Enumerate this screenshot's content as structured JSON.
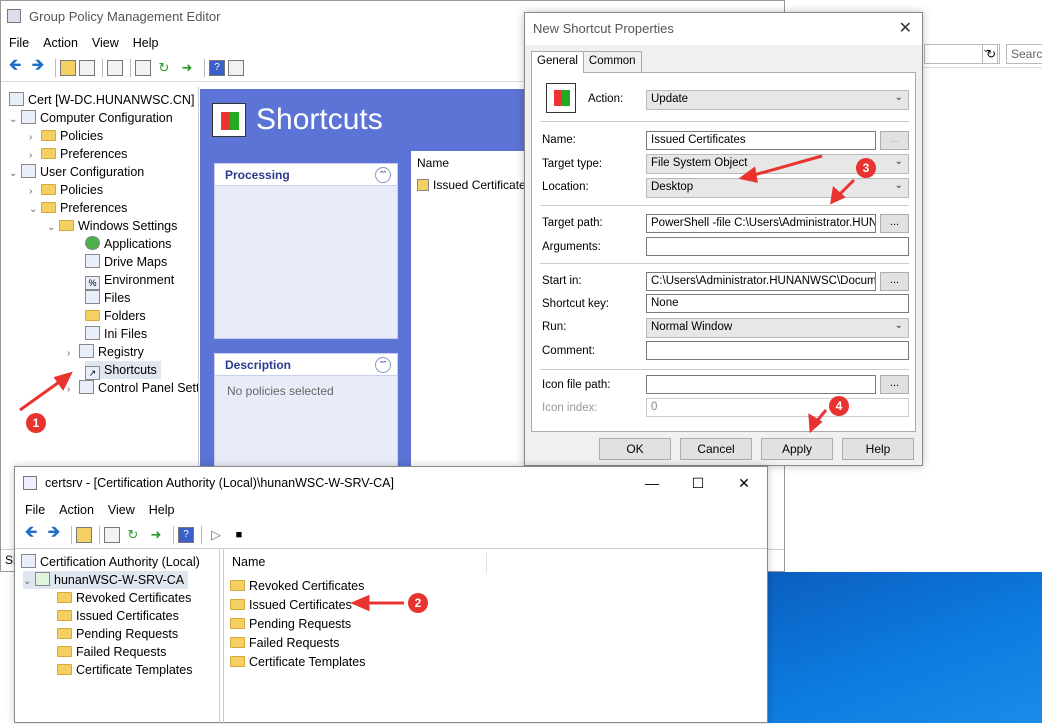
{
  "gpme": {
    "title": "Group Policy Management Editor",
    "menu": [
      "File",
      "Action",
      "View",
      "Help"
    ],
    "tree": {
      "root": "Cert [W-DC.HUNANWSC.CN] P",
      "computer_config": "Computer Configuration",
      "policies1": "Policies",
      "preferences1": "Preferences",
      "user_config": "User Configuration",
      "policies2": "Policies",
      "preferences2": "Preferences",
      "windows_settings": "Windows Settings",
      "applications": "Applications",
      "drive_maps": "Drive Maps",
      "environment": "Environment",
      "files": "Files",
      "folders": "Folders",
      "ini_files": "Ini Files",
      "registry": "Registry",
      "shortcuts": "Shortcuts",
      "control_panel": "Control Panel Setting"
    },
    "pane_title": "Shortcuts",
    "processing": "Processing",
    "description": "Description",
    "no_policies": "No policies selected",
    "list_header": "Name",
    "list_item": "Issued Certificate",
    "status": "Sh"
  },
  "browser": {
    "search_placeholder": "Searc"
  },
  "dialog": {
    "title": "New Shortcut Properties",
    "tabs": [
      "General",
      "Common"
    ],
    "action_label": "Action:",
    "action_value": "Update",
    "name_label": "Name:",
    "name_value": "Issued Certificates",
    "target_type_label": "Target type:",
    "target_type_value": "File System Object",
    "location_label": "Location:",
    "location_value": "Desktop",
    "target_path_label": "Target path:",
    "target_path_value": "PowerShell -file C:\\Users\\Administrator.HUNAN",
    "arguments_label": "Arguments:",
    "arguments_value": "",
    "start_in_label": "Start in:",
    "start_in_value": "C:\\Users\\Administrator.HUNANWSC\\Document",
    "shortcut_key_label": "Shortcut key:",
    "shortcut_key_value": "None",
    "run_label": "Run:",
    "run_value": "Normal Window",
    "comment_label": "Comment:",
    "comment_value": "",
    "icon_path_label": "Icon file path:",
    "icon_path_value": "",
    "icon_index_label": "Icon index:",
    "icon_index_value": "0",
    "browse": "...",
    "ok": "OK",
    "cancel": "Cancel",
    "apply": "Apply",
    "help": "Help"
  },
  "certsrv": {
    "title": "certsrv - [Certification Authority (Local)\\hunanWSC-W-SRV-CA]",
    "menu": [
      "File",
      "Action",
      "View",
      "Help"
    ],
    "tree_root": "Certification Authority (Local)",
    "ca_name": "hunanWSC-W-SRV-CA",
    "folders": [
      "Revoked Certificates",
      "Issued Certificates",
      "Pending Requests",
      "Failed Requests",
      "Certificate Templates"
    ],
    "list_header": "Name",
    "list": [
      "Revoked Certificates",
      "Issued Certificates",
      "Pending Requests",
      "Failed Requests",
      "Certificate Templates"
    ]
  },
  "annotations": [
    "1",
    "2",
    "3",
    "4"
  ],
  "colors": {
    "annotation": "#e8332f",
    "pane_blue": "#5b74d6",
    "desktop": "#0a6cd4"
  }
}
